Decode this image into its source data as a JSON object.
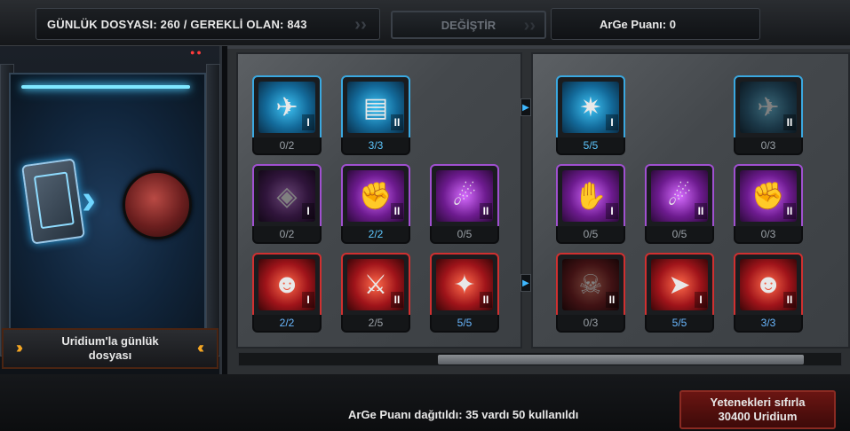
{
  "header": {
    "daily_dossier": "GÜNLÜK DOSYASI: 260 / GEREKLİ OLAN: 843",
    "change_button": "DEĞİŞTİR",
    "research_points": "ArGe Puanı: 0"
  },
  "left_panel": {
    "label_line1": "Uridium'la günlük",
    "label_line2": "dosyası"
  },
  "grid_a": [
    {
      "color": "blue",
      "icon": "jet-fighter-icon",
      "tier": "I",
      "count": "0/2",
      "active": false
    },
    {
      "color": "blue",
      "icon": "cargo-module-icon",
      "tier": "II",
      "count": "3/3",
      "active": true
    },
    {
      "color": "purple",
      "icon": "cube-icon",
      "tier": "I",
      "count": "0/2",
      "active": false,
      "dim": true
    },
    {
      "color": "purple",
      "icon": "fist-icon",
      "tier": "II",
      "count": "2/2",
      "active": true
    },
    {
      "color": "purple",
      "icon": "missile-icon",
      "tier": "II",
      "count": "0/5",
      "active": false
    },
    {
      "color": "red",
      "icon": "alien-head-icon",
      "tier": "I",
      "count": "2/2",
      "active": true
    },
    {
      "color": "red",
      "icon": "rifle-icon",
      "tier": "II",
      "count": "2/5",
      "active": false
    },
    {
      "color": "red",
      "icon": "rocket-blast-icon",
      "tier": "II",
      "count": "5/5",
      "active": true
    }
  ],
  "grid_b": [
    {
      "color": "blue",
      "icon": "ship-beam-icon",
      "tier": "I",
      "count": "5/5",
      "active": true
    },
    {
      "color": "blue",
      "icon": "jet-fighter-icon",
      "tier": "II",
      "count": "0/3",
      "active": false,
      "dim": true
    },
    {
      "color": "purple",
      "icon": "hand-icon",
      "tier": "I",
      "count": "0/5",
      "active": false
    },
    {
      "color": "purple",
      "icon": "missile-icon",
      "tier": "II",
      "count": "0/5",
      "active": false
    },
    {
      "color": "purple",
      "icon": "fist-icon",
      "tier": "II",
      "count": "0/3",
      "active": false
    },
    {
      "color": "red",
      "icon": "skull-icon",
      "tier": "II",
      "count": "0/3",
      "active": false,
      "dim": true
    },
    {
      "color": "red",
      "icon": "ship-icon",
      "tier": "I",
      "count": "5/5",
      "active": true
    },
    {
      "color": "red",
      "icon": "alien-head-icon",
      "tier": "II",
      "count": "3/3",
      "active": true
    }
  ],
  "footer": {
    "status": "ArGe Puanı dağıtıldı: 35 vardı 50 kullanıldı",
    "reset_line1": "Yetenekleri sıfırla",
    "reset_line2": "30400 Uridium"
  },
  "glyphs": {
    "jet-fighter-icon": "✈",
    "cargo-module-icon": "▤",
    "cube-icon": "◈",
    "fist-icon": "✊",
    "missile-icon": "☄",
    "alien-head-icon": "☻",
    "rifle-icon": "⚔",
    "rocket-blast-icon": "✦",
    "ship-beam-icon": "✷",
    "hand-icon": "✋",
    "skull-icon": "☠",
    "ship-icon": "➤"
  }
}
